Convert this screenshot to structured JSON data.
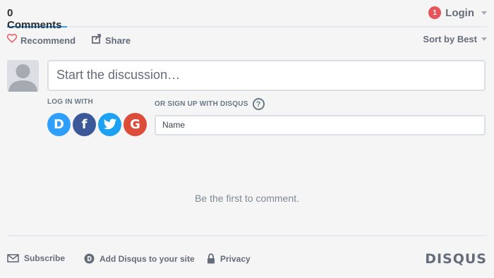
{
  "header": {
    "comments_tab": "0 Comments",
    "notification_count": "1",
    "login_label": "Login"
  },
  "actions": {
    "recommend_label": "Recommend",
    "share_label": "Share",
    "sort_label": "Sort by Best"
  },
  "composer": {
    "placeholder": "Start the discussion…"
  },
  "auth": {
    "login_with_label": "LOG IN WITH",
    "signup_label": "OR SIGN UP WITH DISQUS",
    "help_glyph": "?",
    "name_placeholder": "Name",
    "providers": [
      {
        "name": "disqus",
        "glyph": "D",
        "color": "#2e9fff"
      },
      {
        "name": "facebook",
        "glyph": "f",
        "color": "#3b5999"
      },
      {
        "name": "twitter",
        "glyph": "t",
        "color": "#1da1f2"
      },
      {
        "name": "google",
        "glyph": "G",
        "color": "#dd4b39"
      }
    ]
  },
  "thread": {
    "empty_message": "Be the first to comment."
  },
  "footer": {
    "subscribe_label": "Subscribe",
    "add_disqus_label": "Add Disqus to your site",
    "privacy_label": "Privacy",
    "brand": "DISQUS"
  },
  "colors": {
    "accent": "#2e9fff",
    "badge": "#e9545a",
    "heart": "#e9545a",
    "muted_text": "#656c7a"
  }
}
